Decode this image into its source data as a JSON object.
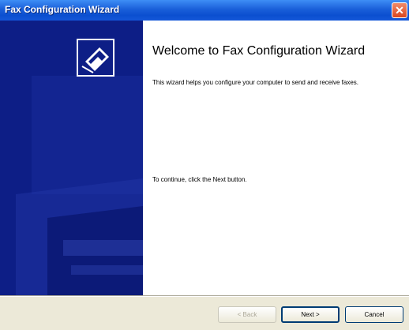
{
  "window": {
    "title": "Fax Configuration Wizard",
    "close_glyph": "✕"
  },
  "content": {
    "heading": "Welcome to Fax Configuration Wizard",
    "intro": "This wizard helps you configure your computer to send and receive faxes.",
    "continue_text": "To continue, click the Next button."
  },
  "buttons": {
    "back": "< Back",
    "next": "Next >",
    "cancel": "Cancel"
  },
  "colors": {
    "banner": "#0d1e86",
    "titlebar": "#1a5fd9",
    "window": "#ece9d8"
  },
  "icons": {
    "banner_icon": "fax-machine-icon"
  }
}
